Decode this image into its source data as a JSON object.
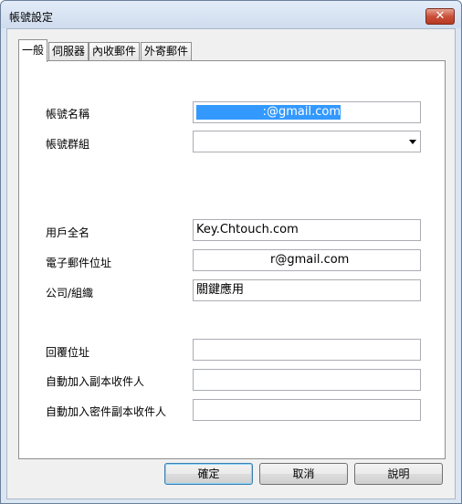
{
  "window": {
    "title": "帳號設定",
    "close_label": "✕"
  },
  "tabs": [
    {
      "label": "一般",
      "active": true
    },
    {
      "label": "伺服器",
      "active": false
    },
    {
      "label": "內收郵件",
      "active": false
    },
    {
      "label": "外寄郵件",
      "active": false
    }
  ],
  "form": {
    "account_name": {
      "label": "帳號名稱",
      "value": ":@gmail.com"
    },
    "account_group": {
      "label": "帳號群組",
      "value": ""
    },
    "full_name": {
      "label": "用戶全名",
      "value": "Key.Chtouch.com"
    },
    "email": {
      "label": "電子郵件位址",
      "value": "r@gmail.com"
    },
    "organization": {
      "label": "公司/組織",
      "value": "關鍵應用"
    },
    "reply_to": {
      "label": "回覆位址",
      "value": ""
    },
    "auto_cc": {
      "label": "自動加入副本收件人",
      "value": ""
    },
    "auto_bcc": {
      "label": "自動加入密件副本收件人",
      "value": ""
    }
  },
  "buttons": {
    "ok": "確定",
    "cancel": "取消",
    "help": "說明"
  },
  "colors": {
    "selection": "#3399ff",
    "titlebar": "#dbe6f3",
    "close": "#c9503a"
  }
}
